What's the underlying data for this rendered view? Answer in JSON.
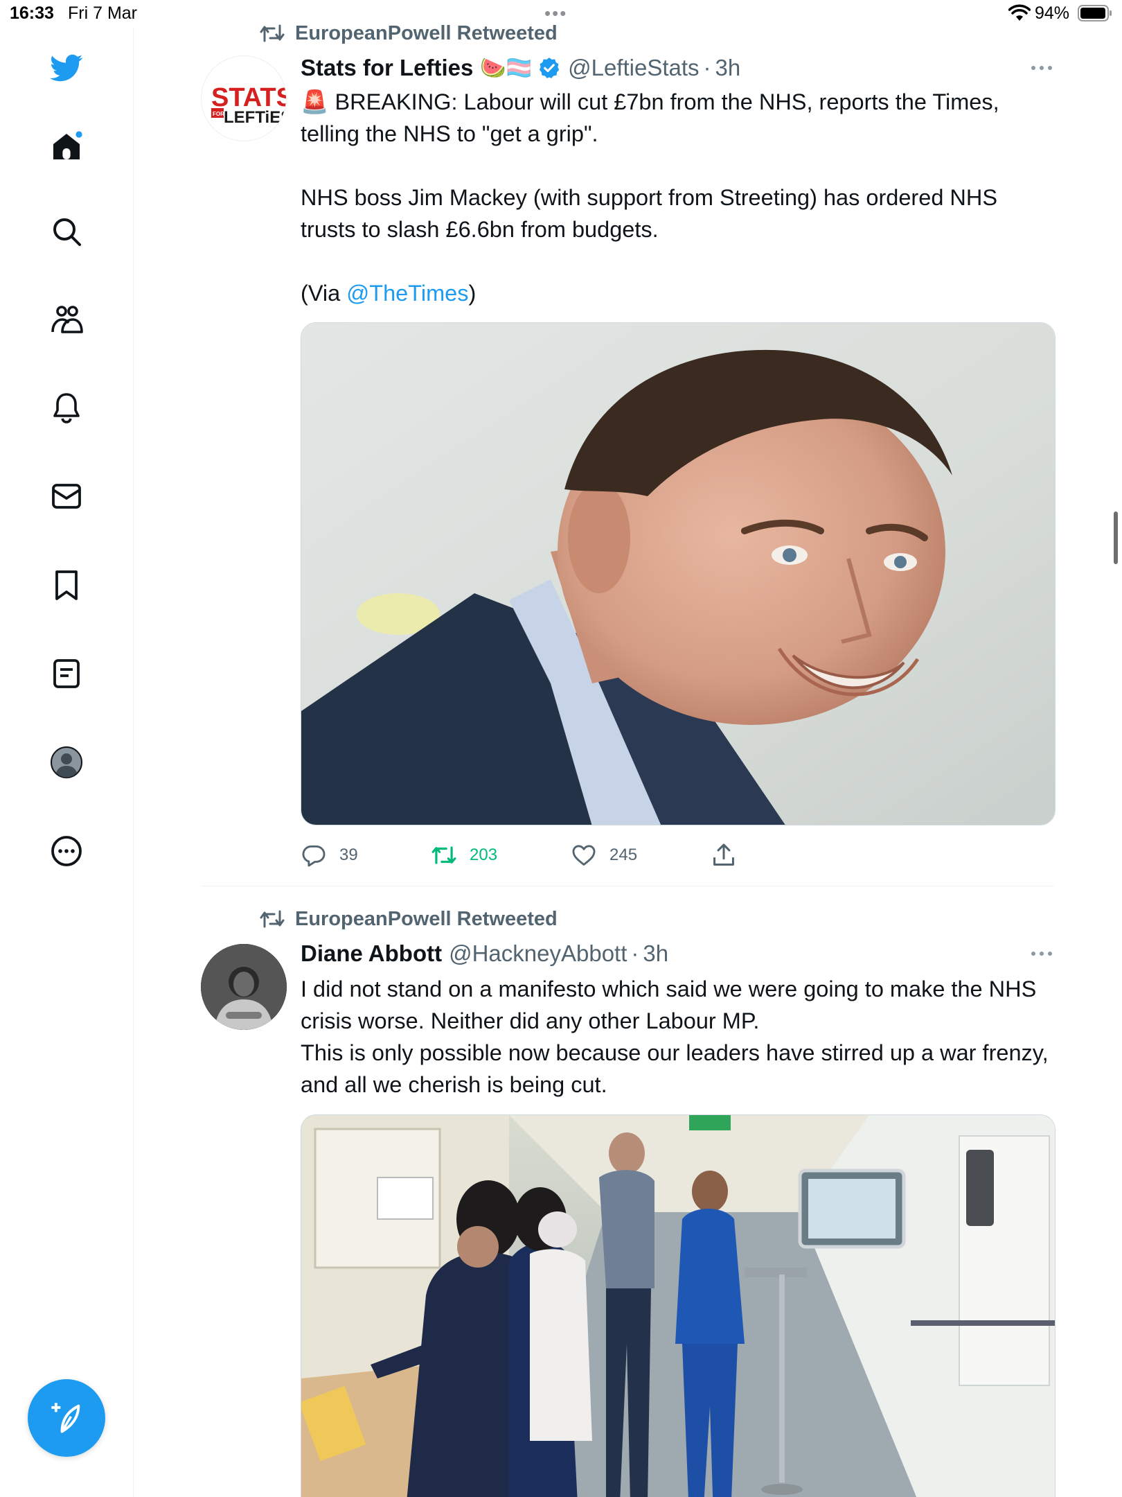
{
  "status_bar": {
    "time": "16:33",
    "date": "Fri 7 Mar",
    "battery": "94%"
  },
  "sidebar": {
    "items": [
      {
        "name": "home-icon"
      },
      {
        "name": "search-icon"
      },
      {
        "name": "communities-icon"
      },
      {
        "name": "notifications-icon"
      },
      {
        "name": "messages-icon"
      },
      {
        "name": "bookmarks-icon"
      },
      {
        "name": "lists-icon"
      },
      {
        "name": "profile-icon"
      },
      {
        "name": "more-icon"
      }
    ],
    "compose_icon": "compose-icon"
  },
  "colors": {
    "accent": "#1d9bf0",
    "retweet_active": "#00ba7c",
    "secondary_text": "#536471"
  },
  "tweets": [
    {
      "retweeted_by": "EuropeanPowell Retweeted",
      "name": "Stats for Lefties",
      "name_emojis": "🍉🏳️‍⚧️",
      "handle": "@LeftieStats",
      "separator": "·",
      "time": "3h",
      "verified": true,
      "avatar_text_top": "STATS",
      "avatar_text_small": "FOR",
      "avatar_text_bottom": "LEFTiES",
      "text_lines": [
        "🚨 BREAKING: Labour will cut £7bn from the NHS, reports the Times, telling the NHS to \"get a grip\".",
        "",
        "NHS boss Jim Mackey (with support from Streeting) has ordered NHS trusts to slash £6.6bn from budgets.",
        ""
      ],
      "via_prefix": "(Via ",
      "via_link": "@TheTimes",
      "via_suffix": ")",
      "replies": "39",
      "retweets": "203",
      "likes": "245"
    },
    {
      "retweeted_by": "EuropeanPowell Retweeted",
      "name": "Diane Abbott",
      "handle": "@HackneyAbbott",
      "separator": "·",
      "time": "3h",
      "text_lines": [
        "I did not stand on a manifesto which said we were going to make the NHS crisis worse. Neither did any other Labour MP.",
        "This is only possible now because our leaders have stirred up a war frenzy, and all we cherish is being cut."
      ]
    }
  ]
}
